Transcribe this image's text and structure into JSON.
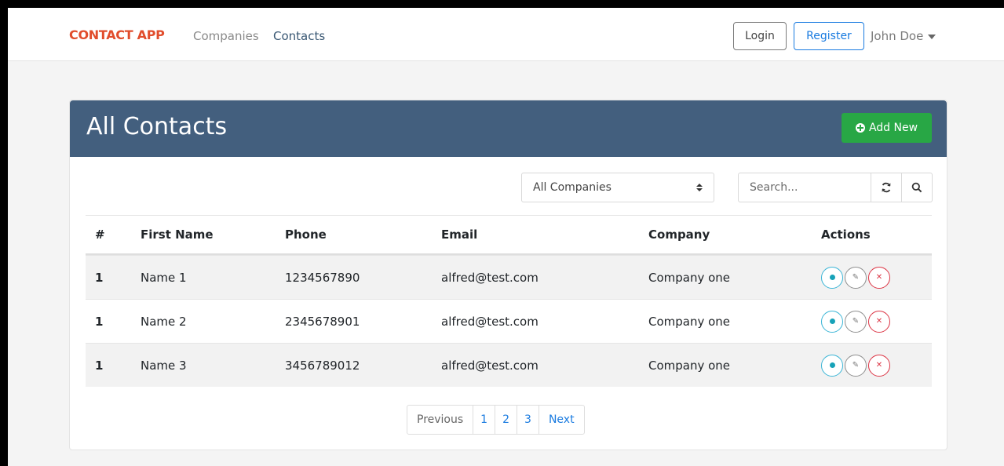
{
  "navbar": {
    "brand": "CONTACT APP",
    "links": [
      "Companies",
      "Contacts"
    ],
    "login_label": "Login",
    "register_label": "Register",
    "user_name": "John Doe"
  },
  "card": {
    "title": "All Contacts",
    "add_button_label": "Add New"
  },
  "filters": {
    "company_select_value": "All Companies",
    "search_placeholder": "Search..."
  },
  "table": {
    "columns": [
      "#",
      "First Name",
      "Phone",
      "Email",
      "Company",
      "Actions"
    ],
    "rows": [
      {
        "num": "1",
        "first_name": "Name 1",
        "phone": "1234567890",
        "email": "alfred@test.com",
        "company": "Company one"
      },
      {
        "num": "1",
        "first_name": "Name 2",
        "phone": "2345678901",
        "email": "alfred@test.com",
        "company": "Company one"
      },
      {
        "num": "1",
        "first_name": "Name 3",
        "phone": "3456789012",
        "email": "alfred@test.com",
        "company": "Company one"
      }
    ]
  },
  "pagination": {
    "previous_label": "Previous",
    "pages": [
      "1",
      "2",
      "3"
    ],
    "next_label": "Next"
  },
  "colors": {
    "brand": "#e14d2c",
    "header_bg": "#435f7e",
    "add_button": "#28a745",
    "link": "#1a7be0"
  },
  "icons": {
    "add": "plus-circle-icon",
    "refresh": "refresh-icon",
    "search": "search-icon",
    "view": "eye-icon",
    "edit": "edit-icon",
    "delete": "delete-icon",
    "select_arrows": "sort-arrows-icon",
    "user_menu": "caret-down-icon"
  }
}
